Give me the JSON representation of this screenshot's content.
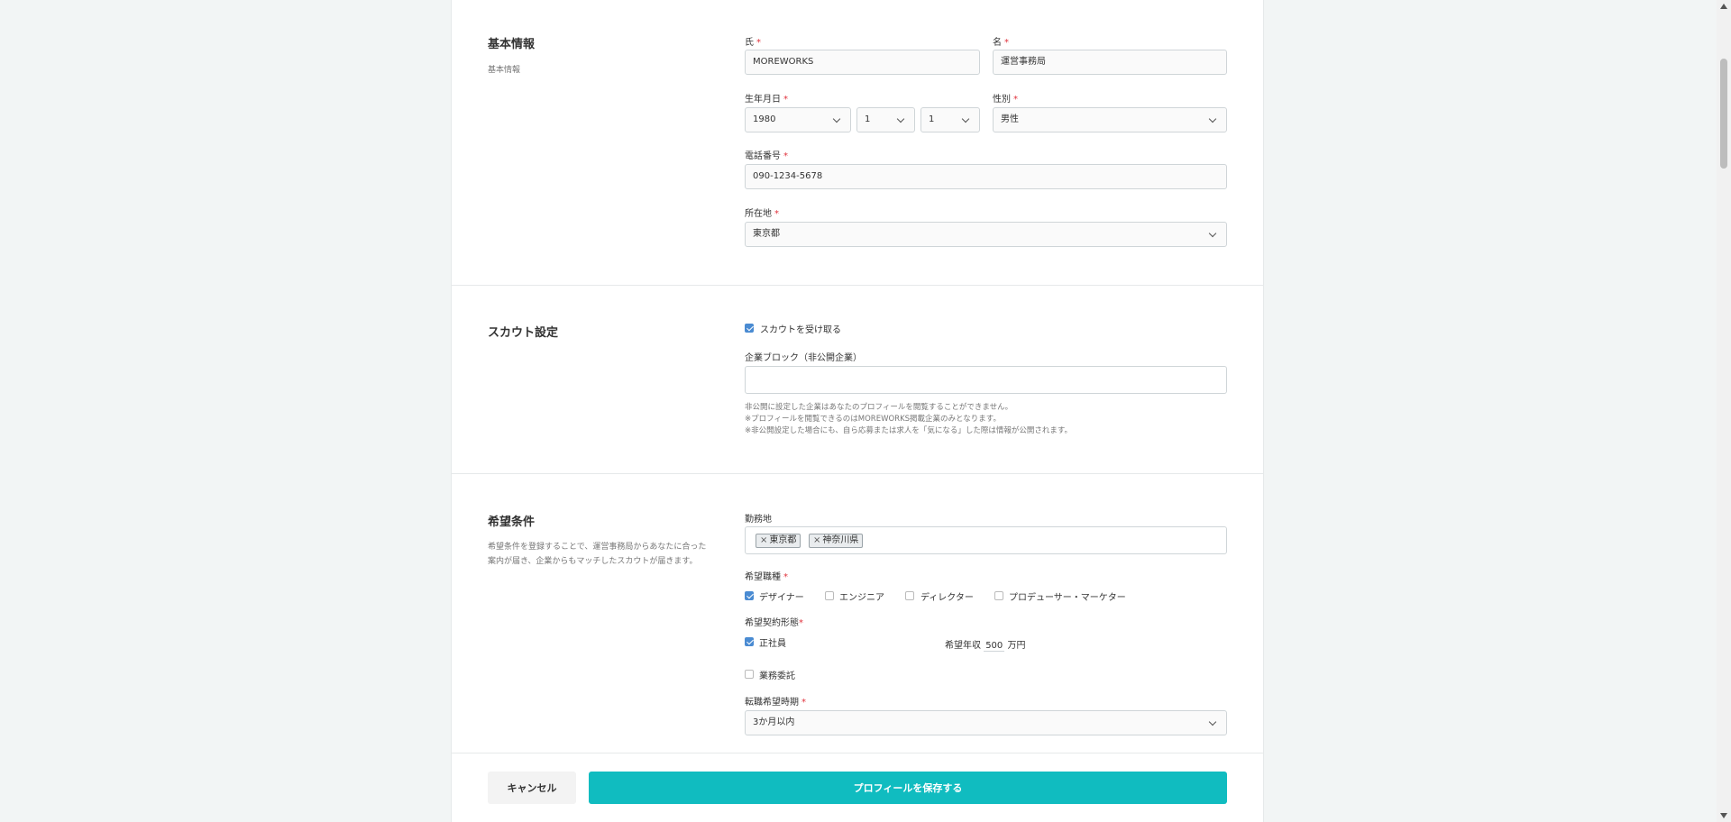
{
  "basic": {
    "title": "基本情報",
    "desc": "基本情報",
    "last_name_label": "氏",
    "last_name_value": "MOREWORKS",
    "first_name_label": "名",
    "first_name_value": "運営事務局",
    "birth_label": "生年月日",
    "birth_year": "1980",
    "birth_month": "1",
    "birth_day": "1",
    "gender_label": "性別",
    "gender_value": "男性",
    "phone_label": "電話番号",
    "phone_value": "090-1234-5678",
    "location_label": "所在地",
    "location_value": "東京都",
    "required_mark": "*"
  },
  "scout": {
    "title": "スカウト設定",
    "receive_label": "スカウトを受け取る",
    "receive_checked": true,
    "block_label": "企業ブロック（非公開企業）",
    "block_value": "",
    "note1": "非公開に設定した企業はあなたのプロフィールを閲覧することができません。",
    "note2": "※プロフィールを閲覧できるのはMOREWORKS掲載企業のみとなります。",
    "note3": "※非公開設定した場合にも、自ら応募または求人を「気になる」した際は情報が公開されます。"
  },
  "wish": {
    "title": "希望条件",
    "desc": "希望条件を登録することで、運営事務局からあなたに合った案内が届き、企業からもマッチしたスカウトが届きます。",
    "workplace_label": "勤務地",
    "workplace_tags": [
      "東京都",
      "神奈川県"
    ],
    "tag_remove": "×",
    "job_label": "希望職種",
    "jobs": [
      {
        "label": "デザイナー",
        "checked": true
      },
      {
        "label": "エンジニア",
        "checked": false
      },
      {
        "label": "ディレクター",
        "checked": false
      },
      {
        "label": "プロデューサー・マーケター",
        "checked": false
      }
    ],
    "contract_label": "希望契約形態",
    "contract_fulltime": "正社員",
    "contract_fulltime_checked": true,
    "salary_prefix": "希望年収",
    "salary_value": "500",
    "salary_suffix": "万円",
    "contract_outsource": "業務委託",
    "contract_outsource_checked": false,
    "timing_label": "転職希望時期",
    "timing_value": "3か月以内"
  },
  "footer": {
    "cancel_label": "キャンセル",
    "save_label": "プロフィールを保存する"
  }
}
